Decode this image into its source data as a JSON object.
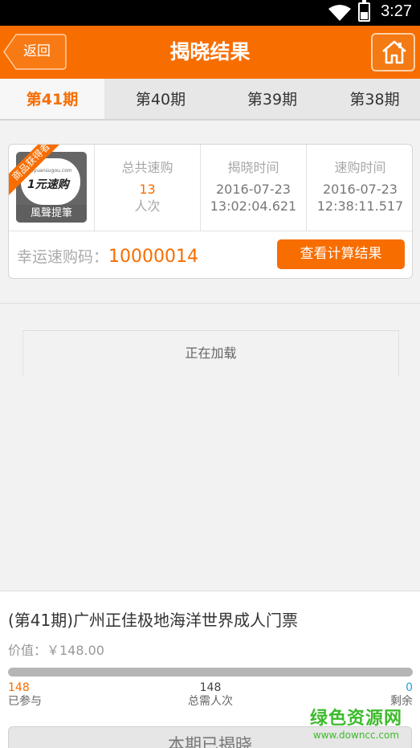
{
  "status_bar": {
    "time": "3:27"
  },
  "header": {
    "title": "揭晓结果",
    "back_label": "返回"
  },
  "tabs": [
    {
      "label": "第41期",
      "active": true
    },
    {
      "label": "第40期",
      "active": false
    },
    {
      "label": "第39期",
      "active": false
    },
    {
      "label": "第38期",
      "active": false
    }
  ],
  "result": {
    "ribbon": "商品获得者",
    "logo_text": "1元速购",
    "logo_small": "1yuansugou.com",
    "winner_name": "風聲提筆",
    "columns": [
      {
        "label": "总共速购",
        "value": "13",
        "unit": "人次"
      },
      {
        "label": "揭晓时间",
        "date": "2016-07-23",
        "time": "13:02:04.621"
      },
      {
        "label": "速购时间",
        "date": "2016-07-23",
        "time": "12:38:11.517"
      }
    ],
    "lucky_label": "幸运速购码：",
    "lucky_code": "10000014",
    "calc_button": "查看计算结果"
  },
  "loading_text": "正在加载",
  "product": {
    "title": "(第41期)广州正佳极地海洋世界成人门票",
    "price": "价值：￥148.00",
    "progress_fraction": 1.0,
    "joined": {
      "value": "148",
      "label": "已参与"
    },
    "total": {
      "value": "148",
      "label": "总需人次"
    },
    "remaining": {
      "value": "0",
      "label": "剩余"
    },
    "status_button": "本期已揭晓"
  },
  "watermark": {
    "big": "绿色资源网",
    "small": "www.downcc.com"
  },
  "colors": {
    "accent": "#f76d00",
    "remaining": "#2a9fd8"
  }
}
